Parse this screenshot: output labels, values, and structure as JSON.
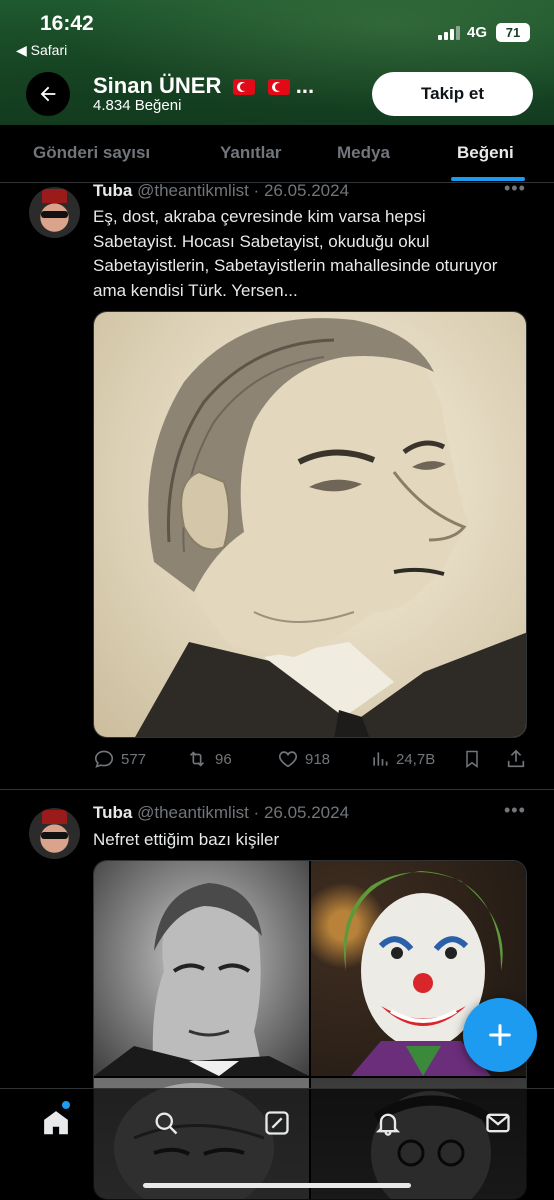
{
  "status_bar": {
    "time": "16:42",
    "back_app": "◀ Safari",
    "network": "4G",
    "battery": "71"
  },
  "header": {
    "profile_name": "Sinan ÜNER",
    "name_suffix": "...",
    "like_count": "4.834 Beğeni",
    "follow_label": "Takip et"
  },
  "tabs": [
    {
      "label": "Gönderi sayısı",
      "active": false
    },
    {
      "label": "Yanıtlar",
      "active": false
    },
    {
      "label": "Medya",
      "active": false
    },
    {
      "label": "Beğeni",
      "active": true
    }
  ],
  "posts": [
    {
      "author": "Tuba",
      "handle_date": "@theantikmlist · 26.05.2024",
      "text": "Eş, dost, akraba çevresinde kim varsa hepsi Sabetayist. Hocası Sabetayist, okuduğu okul Sabetayistlerin, Sabetayistlerin mahallesinde oturuyor ama kendisi Türk. Yersen...",
      "replies": "577",
      "reposts": "96",
      "likes": "918",
      "views": "24,7B"
    },
    {
      "author": "Tuba",
      "handle_date": "@theantikmlist · 26.05.2024",
      "text": "Nefret ettiğim bazı kişiler"
    }
  ],
  "colors": {
    "accent": "#1d9bf0",
    "header_green": "#1f5a2f",
    "muted": "#71767b"
  },
  "icons": [
    "back-arrow-icon",
    "more-icon",
    "reply-icon",
    "repost-icon",
    "like-icon",
    "views-icon",
    "bookmark-icon",
    "share-icon",
    "plus-icon",
    "home-icon",
    "search-icon",
    "grok-icon",
    "notifications-icon",
    "messages-icon"
  ]
}
